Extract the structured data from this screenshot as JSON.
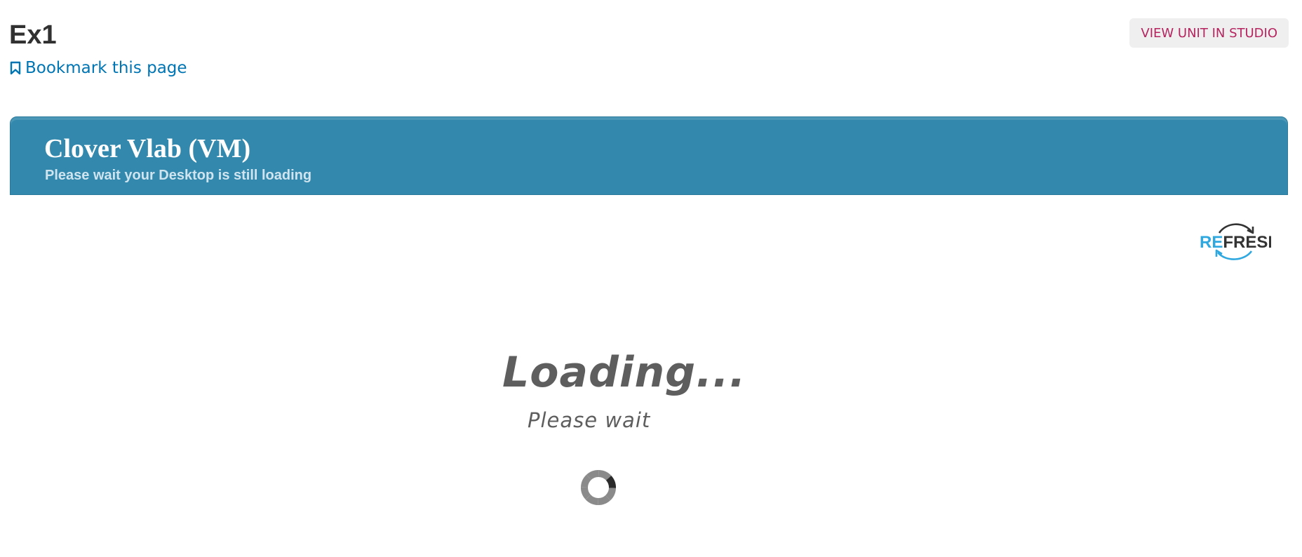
{
  "header": {
    "unit_title": "Ex1",
    "bookmark_label": "Bookmark this page",
    "studio_button_label": "VIEW UNIT IN STUDIO"
  },
  "vlab": {
    "title": "Clover Vlab (VM)",
    "subtitle": "Please wait your Desktop is still loading",
    "refresh": {
      "label_part1": "RE",
      "label_part2": "FRESH",
      "icon": "refresh-icon"
    }
  },
  "loading": {
    "heading": "Loading...",
    "message": "Please wait",
    "spinner_icon": "spinner-icon"
  },
  "colors": {
    "banner": "#3289ad",
    "link": "#0075b4",
    "studio_text": "#b5245f",
    "refresh_blue": "#2fa8e0",
    "refresh_dark": "#333333"
  }
}
